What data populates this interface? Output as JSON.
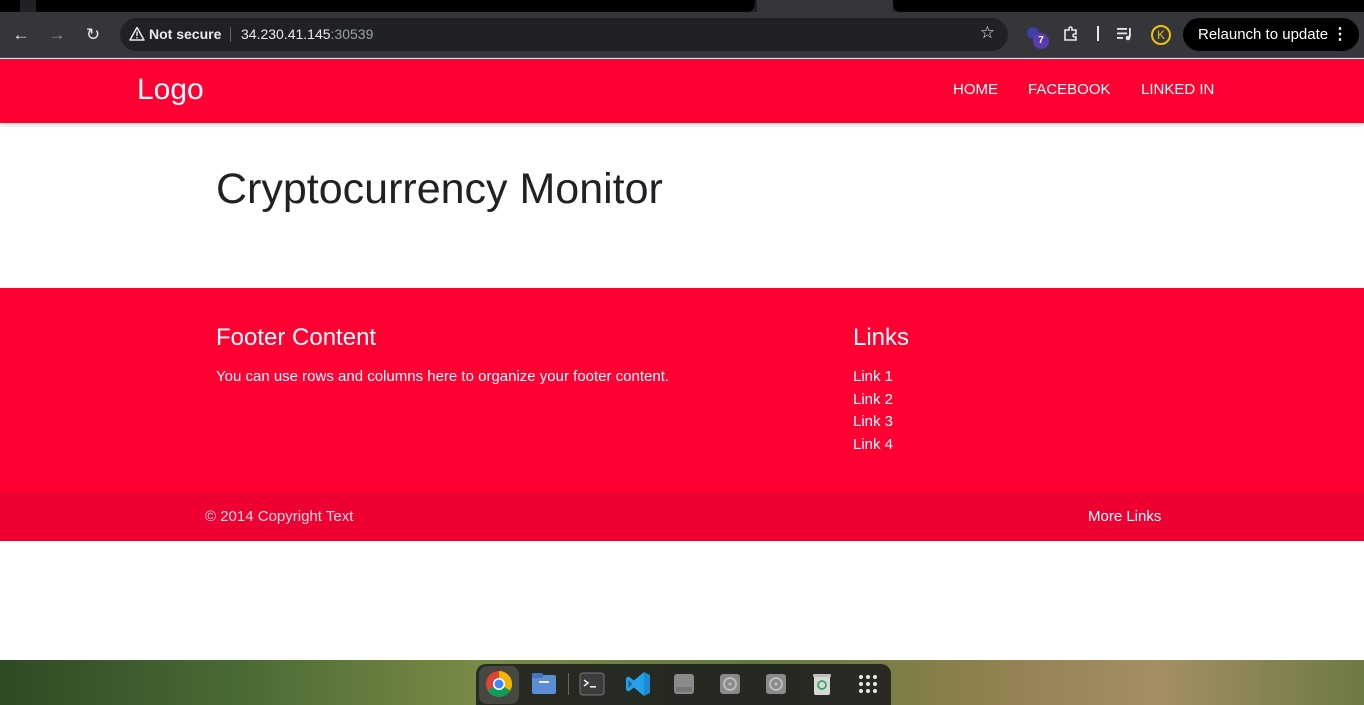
{
  "browser": {
    "address_bar": {
      "security_label": "Not secure",
      "url_host": "34.230.41.145",
      "url_port": ":30539"
    },
    "extension_badge_count": "7",
    "profile_initial": "K",
    "relaunch_label": "Relaunch to update"
  },
  "site": {
    "logo": "Logo",
    "nav_links": [
      "HOME",
      "FACEBOOK",
      "LINKED IN"
    ],
    "title": "Cryptocurrency Monitor",
    "footer": {
      "content_heading": "Footer Content",
      "content_text": "You can use rows and columns here to organize your footer content.",
      "links_heading": "Links",
      "links": [
        "Link 1",
        "Link 2",
        "Link 3",
        "Link 4"
      ]
    },
    "copyright": "© 2014 Copyright Text",
    "more_links": "More Links"
  },
  "colors": {
    "brand_red": "#ff0033",
    "copyright_bar": "#ee0033",
    "browser_toolbar": "#35363a"
  },
  "dock": {
    "apps": [
      "chrome-icon",
      "files-icon",
      "terminal-icon",
      "vscode-icon",
      "ssd-drive-icon",
      "disc-icon",
      "disc-icon",
      "trash-icon",
      "app-grid-icon"
    ]
  }
}
